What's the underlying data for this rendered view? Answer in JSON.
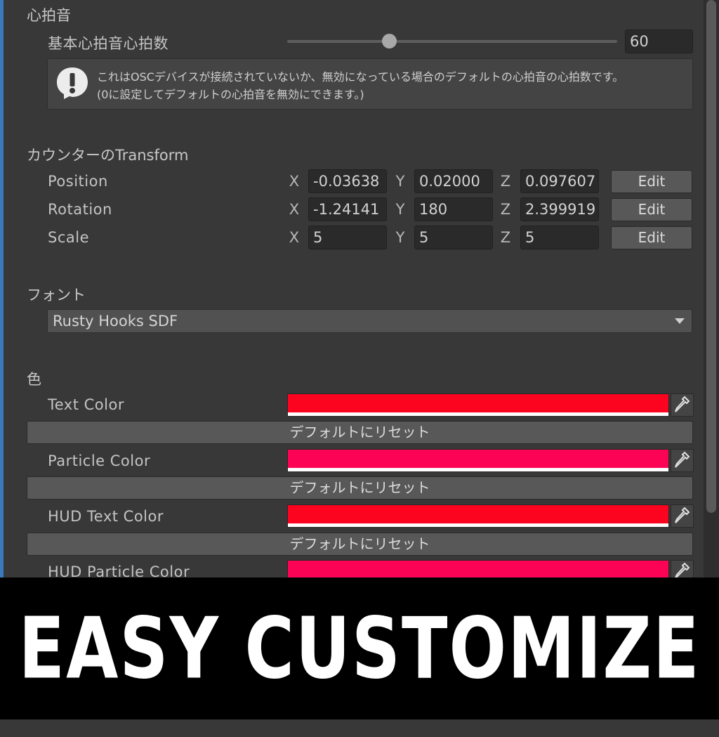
{
  "heartbeat": {
    "section_title": "心拍音",
    "base_label": "基本心拍音心拍数",
    "base_value": "60",
    "slider_fraction": 0.31,
    "help_icon": "warning-bubble-icon",
    "help_line1": "これはOSCデバイスが接続されていないか、無効になっている場合のデフォルトの心拍音の心拍数です。",
    "help_line2": "(0に設定してデフォルトの心拍音を無効にできます。)"
  },
  "transform": {
    "section_title": "カウンターのTransform",
    "axis_x": "X",
    "axis_y": "Y",
    "axis_z": "Z",
    "edit_label": "Edit",
    "rows": [
      {
        "label": "Position",
        "x": "-0.03638",
        "y": "0.02000",
        "z": "0.097607"
      },
      {
        "label": "Rotation",
        "x": "-1.24141",
        "y": "180",
        "z": "2.399919"
      },
      {
        "label": "Scale",
        "x": "5",
        "y": "5",
        "z": "5"
      }
    ]
  },
  "font": {
    "section_title": "フォント",
    "selected": "Rusty Hooks SDF"
  },
  "colors": {
    "section_title": "色",
    "reset_label": "デフォルトにリセット",
    "picker_icon": "eyedropper-icon",
    "items": [
      {
        "label": "Text Color",
        "color": "#fc0320"
      },
      {
        "label": "Particle Color",
        "color": "#fc0356"
      },
      {
        "label": "HUD Text Color",
        "color": "#fc0320"
      },
      {
        "label": "HUD Particle Color",
        "color": "#fc0356"
      }
    ]
  },
  "banner": {
    "text": "EASY CUSTOMIZE"
  },
  "theme": {
    "accent": "#3a79bb",
    "background": "#383838"
  }
}
